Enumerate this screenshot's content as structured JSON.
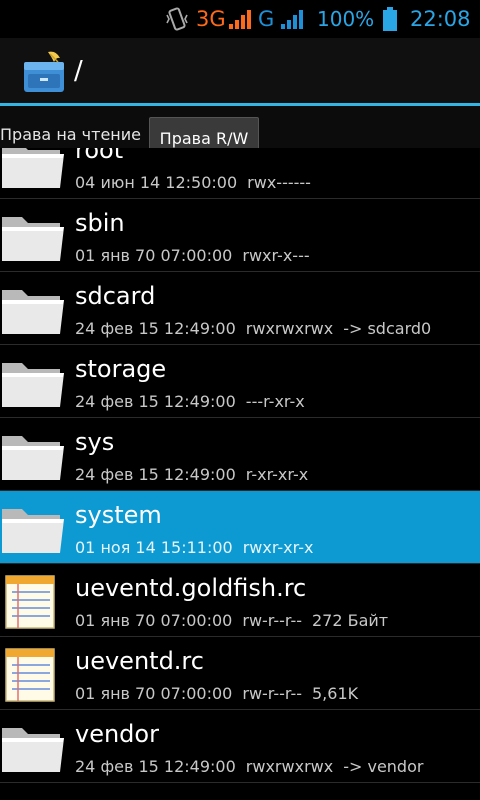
{
  "status_bar": {
    "network_3g": "3G",
    "network_g": "G",
    "battery_percent": "100%",
    "time": "22:08",
    "icons": [
      "vibrate-icon",
      "signal-3g-icon",
      "signal-g-icon",
      "battery-icon"
    ],
    "colors": {
      "accent": "#2aa6e6",
      "net3g": "#ff6a1a"
    }
  },
  "action_bar": {
    "path": "/",
    "app_icon": "file-manager-icon",
    "accent": "#33b5e5"
  },
  "permissions": {
    "read_label": "Права на чтение",
    "rw_button": "Права R/W"
  },
  "files": [
    {
      "name": "root",
      "date": "04 июн 14 12:50:00",
      "perms": "rwx------",
      "extra": "",
      "type": "folder"
    },
    {
      "name": "sbin",
      "date": "01 янв 70 07:00:00",
      "perms": "rwxr-x---",
      "extra": "",
      "type": "folder"
    },
    {
      "name": "sdcard",
      "date": "24 фев 15 12:49:00",
      "perms": "rwxrwxrwx",
      "extra": "-> sdcard0",
      "type": "folder"
    },
    {
      "name": "storage",
      "date": "24 фев 15 12:49:00",
      "perms": "---r-xr-x",
      "extra": "",
      "type": "folder"
    },
    {
      "name": "sys",
      "date": "24 фев 15 12:49:00",
      "perms": "r-xr-xr-x",
      "extra": "",
      "type": "folder"
    },
    {
      "name": "system",
      "date": "01 ноя 14 15:11:00",
      "perms": "rwxr-xr-x",
      "extra": "",
      "type": "folder",
      "selected": true
    },
    {
      "name": "ueventd.goldfish.rc",
      "date": "01 янв 70 07:00:00",
      "perms": "rw-r--r--",
      "extra": "272 Байт",
      "type": "text-file"
    },
    {
      "name": "ueventd.rc",
      "date": "01 янв 70 07:00:00",
      "perms": "rw-r--r--",
      "extra": "5,61K",
      "type": "text-file"
    },
    {
      "name": "vendor",
      "date": "24 фев 15 12:49:00",
      "perms": "rwxrwxrwx",
      "extra": "-> vendor",
      "type": "folder"
    }
  ],
  "colors": {
    "selected_row": "#0d9ad2"
  }
}
